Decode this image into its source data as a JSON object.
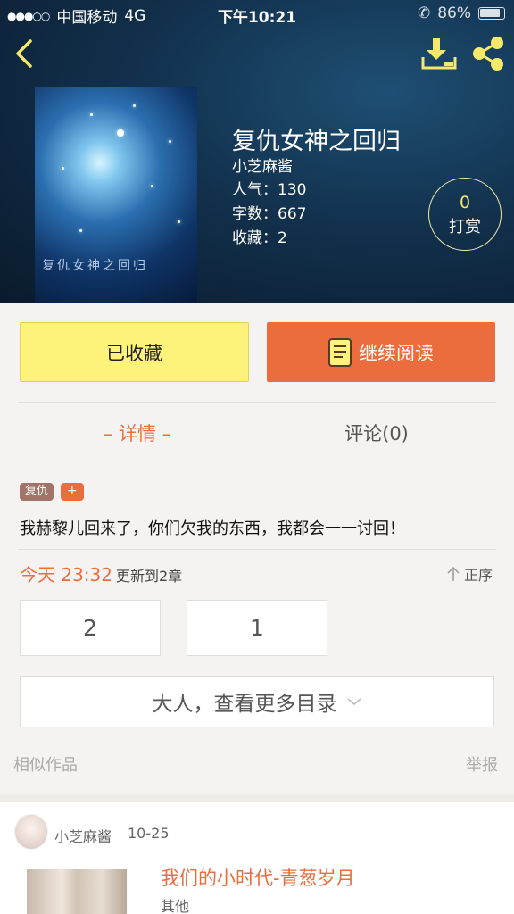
{
  "status_bar": {
    "carrier": "中国移动",
    "network": "4G",
    "time": "下午10:21",
    "battery": "86%"
  },
  "nav": {
    "back_icon": "chevron-left-icon",
    "download_icon": "download-icon",
    "share_icon": "share-icon"
  },
  "book": {
    "title": "复仇女神之回归",
    "author": "小芝麻酱",
    "popularity": "人气：130",
    "word_count": "字数：667",
    "favorites": "收藏：2",
    "cover_text": "复仇女神之回归",
    "tip_count": "0",
    "tip_label": "打赏"
  },
  "actions": {
    "collected_label": "已收藏",
    "continue_label": "继续阅读"
  },
  "tabs": {
    "detail": "– 详情 –",
    "comments": "评论(0)"
  },
  "tags": [
    "复仇",
    "+"
  ],
  "summary": "我赫黎儿回来了，你们欠我的东西，我都会一一讨回！",
  "update": {
    "time": "今天 23:32",
    "text": "更新到2章",
    "sort_label": "正序"
  },
  "chapters": [
    "2",
    "1"
  ],
  "more_catalog": "大人，查看更多目录",
  "similar": {
    "heading": "相似作品",
    "report": "举报",
    "item": {
      "author": "小芝麻酱",
      "date": "10-25",
      "title": "我们的小时代-青葱岁月",
      "genre": "其他"
    }
  },
  "colors": {
    "accent": "#eb6d3e",
    "collected_bg": "#fdf27a",
    "nav_icon": "#f6e86b"
  }
}
